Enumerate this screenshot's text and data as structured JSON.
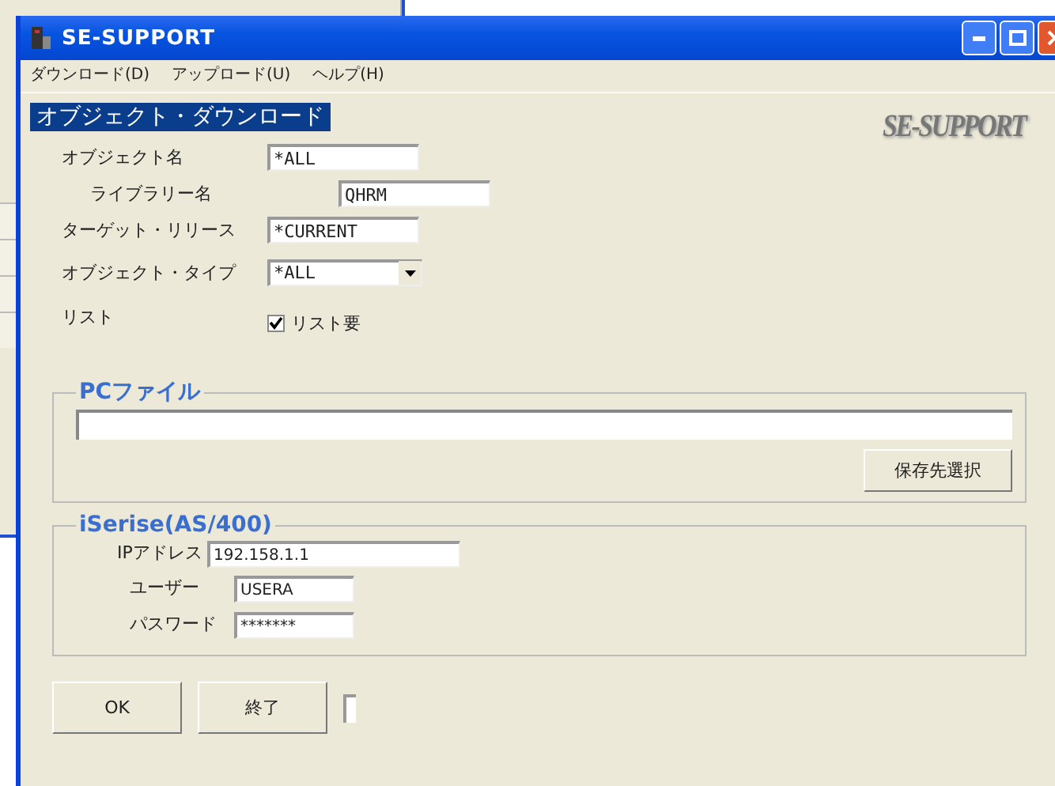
{
  "window": {
    "title": "SE-SUPPORT"
  },
  "menu": [
    {
      "label": "ダウンロード(D)"
    },
    {
      "label": "アップロード(U)"
    },
    {
      "label": "ヘルプ(H)"
    }
  ],
  "heading": "オブジェクト・ダウンロード",
  "logo": "SE-SUPPORT",
  "form": [
    {
      "kind": "text",
      "label": "オブジェクト名",
      "value": "*ALL"
    },
    {
      "kind": "subtext",
      "label": "ライブラリー名",
      "value": "QHRM"
    },
    {
      "kind": "text",
      "label": "ターゲット・リリース",
      "value": "*CURRENT"
    },
    {
      "kind": "select",
      "label": "オブジェクト・タイプ",
      "value": "*ALL"
    },
    {
      "kind": "checkbox",
      "label": "リスト",
      "option": "リスト要",
      "checked": true
    }
  ],
  "pc_file": {
    "title": "PCファイル",
    "button": "保存先選択"
  },
  "server": {
    "title": "iSerise(AS/400)",
    "fields": [
      {
        "label": "IPアドレス",
        "value": "192.158.1.1"
      },
      {
        "label": "ユーザー",
        "value": "USERA"
      },
      {
        "label": "パスワード",
        "value": "*******"
      }
    ]
  },
  "buttons": [
    "OK",
    "終了"
  ]
}
